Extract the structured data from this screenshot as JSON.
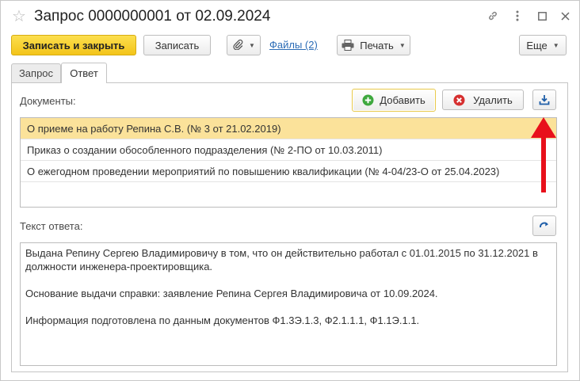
{
  "window": {
    "title": "Запрос 0000000001 от 02.09.2024"
  },
  "toolbar": {
    "save_close_label": "Записать и закрыть",
    "save_label": "Записать",
    "files_link": "Файлы (2)",
    "print_label": "Печать",
    "more_label": "Еще"
  },
  "tabs": [
    {
      "label": "Запрос",
      "active": false
    },
    {
      "label": "Ответ",
      "active": true
    }
  ],
  "documents": {
    "label": "Документы:",
    "add_label": "Добавить",
    "delete_label": "Удалить",
    "rows": [
      {
        "text": "О приеме на работу Репина С.В. (№ 3 от 21.02.2019)",
        "selected": true
      },
      {
        "text": "Приказ о создании обособленного подразделения (№ 2-ПО от 10.03.2011)",
        "selected": false
      },
      {
        "text": "О ежегодном проведении мероприятий по повышению квалификации (№ 4-04/23-О от 25.04.2023)",
        "selected": false
      }
    ]
  },
  "answer": {
    "label": "Текст ответа:",
    "paragraphs": [
      "Выдана Репину Сергею Владимировичу в том, что он действительно работал с 01.01.2015 по 31.12.2021 в должности инженера-проектировщика.",
      "Основание выдачи справки: заявление Репина Сергея Владимировича от 10.09.2024.",
      "Информация подготовлена по данным документов Ф1.3Э.1.3, Ф2.1.1.1, Ф1.1Э.1.1."
    ]
  },
  "icons": {
    "favorite": "star-icon",
    "link": "link-icon",
    "menu": "more-vertical-icon",
    "maximize": "maximize-icon",
    "close": "close-icon",
    "attach": "paperclip-icon",
    "print": "printer-icon",
    "add": "plus-circle-icon",
    "delete": "x-circle-icon",
    "download": "download-icon",
    "redo": "redo-icon",
    "annotation": "red-arrow-up"
  },
  "colors": {
    "primary_button": "#f3c41a",
    "selected_row": "#fbe29a",
    "link": "#2b6cb6",
    "add_icon": "#3ea83e",
    "delete_icon": "#d62f2f",
    "annotation_arrow": "#e8101b"
  }
}
